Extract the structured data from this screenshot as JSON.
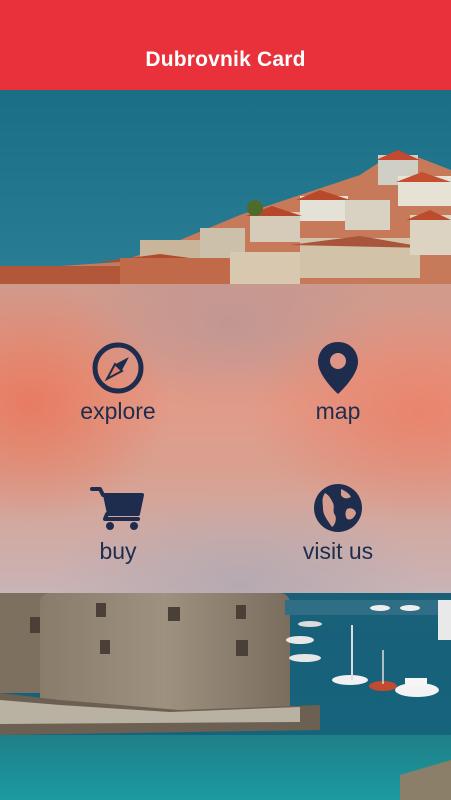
{
  "header": {
    "title": "Dubrovnik Card"
  },
  "menu": {
    "items": [
      {
        "label": "explore",
        "icon": "compass-icon"
      },
      {
        "label": "map",
        "icon": "map-pin-icon"
      },
      {
        "label": "buy",
        "icon": "shopping-cart-icon"
      },
      {
        "label": "visit us",
        "icon": "globe-icon"
      }
    ]
  },
  "colors": {
    "header_background": "#e8313a",
    "header_text": "#ffffff",
    "icon_and_label": "#1e2d4d"
  }
}
